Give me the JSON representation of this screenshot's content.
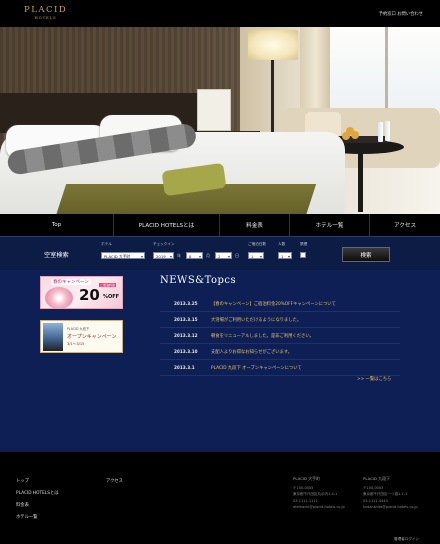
{
  "header": {
    "logo_main": "PLACID",
    "logo_sub": "HOTELS",
    "contact": "予約窓口 お問い合わせ"
  },
  "nav": {
    "items": [
      {
        "label": "Top"
      },
      {
        "label": "PLACID HOTELSとは"
      },
      {
        "label": "料金表"
      },
      {
        "label": "ホテル一覧"
      },
      {
        "label": "アクセス"
      }
    ]
  },
  "search": {
    "title": "空室検索",
    "hotel_label": "ホテル",
    "hotel_value": "PLACID 大手町",
    "checkin_label": "チェックイン",
    "year_value": "2019",
    "year_unit": "年",
    "month_value": "8",
    "month_unit": "月",
    "day_value": "2",
    "day_unit": "日",
    "nights_label": "ご宿泊日数",
    "nights_value": "1",
    "people_label": "人数",
    "people_value": "1",
    "smoking_label": "禁煙",
    "button": "検索"
  },
  "banners": {
    "spring_head": "春のキャンペーン",
    "spring_tag": "ご宿泊料金",
    "spring_big": "20",
    "spring_off": "%OFF",
    "kudan_small": "PLACID 九段下",
    "kudan_main": "オープンキャンペーン",
    "kudan_date": "3/1〜3/15"
  },
  "news": {
    "title": "NEWS&Topcs",
    "items": [
      {
        "date": "2013.3.25",
        "text": "【春のキャンペーン】ご宿泊料金20%OFFキャンペーンについて"
      },
      {
        "date": "2013.3.15",
        "text": "大浴場がご利用いただけるようになりました。"
      },
      {
        "date": "2013.3.12",
        "text": "朝食をリニューアルしました。是非ご利用ください。"
      },
      {
        "date": "2013.3.10",
        "text": "支配人よりお得なお知らせがございます。"
      },
      {
        "date": "2013.3.1",
        "text": "PLACID 九段下 オープンキャンペーンについて"
      }
    ],
    "more": ">> 一覧はこちら"
  },
  "footer": {
    "links": {
      "top": "トップ",
      "about": "PLACID HOTELSとは",
      "price": "料金表",
      "hotels": "ホテル一覧",
      "access": "アクセス"
    },
    "hotel1": {
      "name": "PLACID 大手町",
      "zip": "〒100-0005",
      "addr": "東京都千代田区丸の内1-4-1",
      "tel": "03-1111-1111",
      "mail": "otemachi@placid-hotels.co.jp"
    },
    "hotel2": {
      "name": "PLACID 九段下",
      "zip": "〒100-0003",
      "addr": "東京都千代田区一ツ橋1-1-1",
      "tel": "03-1111-4444",
      "mail": "kudanshita@placid-hotels.co.jp"
    },
    "admin": "管理者ログイン"
  }
}
